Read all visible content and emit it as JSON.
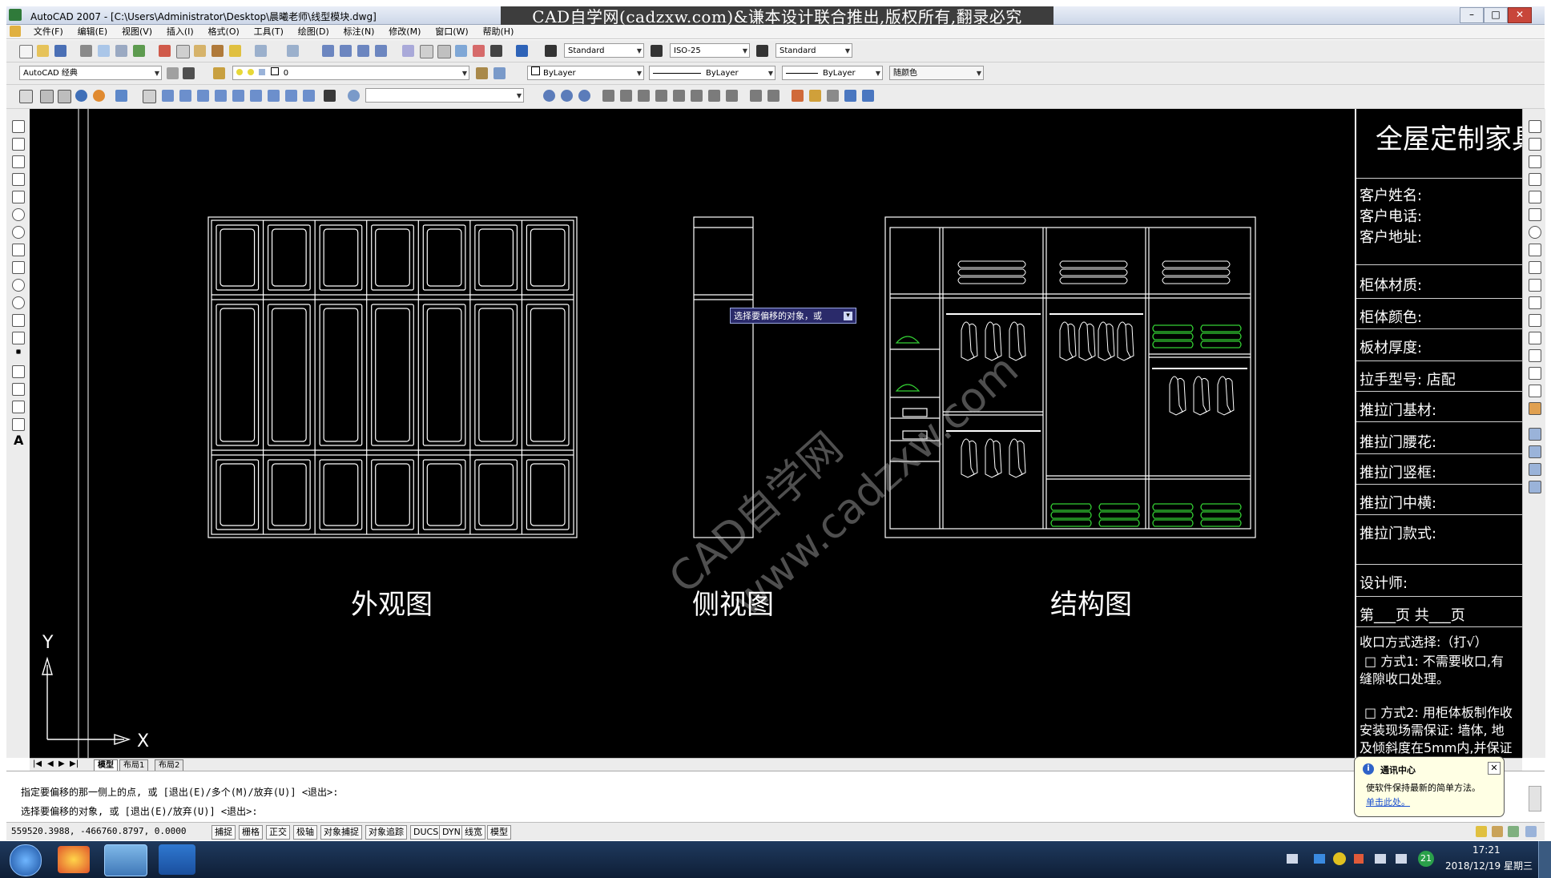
{
  "window": {
    "title": "AutoCAD 2007 - [C:\\Users\\Administrator\\Desktop\\晨曦老师\\线型模块.dwg]",
    "banner": "CAD自学网(cadzxw.com)&谦本设计联合推出,版权所有,翻录必究",
    "controls": [
      "–",
      "□",
      "✕"
    ]
  },
  "menu": [
    "文件(F)",
    "编辑(E)",
    "视图(V)",
    "插入(I)",
    "格式(O)",
    "工具(T)",
    "绘图(D)",
    "标注(N)",
    "修改(M)",
    "窗口(W)",
    "帮助(H)"
  ],
  "toolbar": {
    "text_style": "Standard",
    "dim_style": "ISO-25",
    "table_style": "Standard",
    "workspace": "AutoCAD 经典",
    "layer": "0",
    "color": "ByLayer",
    "linetype": "ByLayer",
    "lineweight": "ByLayer",
    "plotstyle": "随颜色"
  },
  "drawing": {
    "label_exterior": "外观图",
    "label_side": "侧视图",
    "label_structure": "结构图",
    "tooltip": "选择要偏移的对象，或",
    "watermark_1": "CAD自学网",
    "watermark_2": "www.cadzxw.com",
    "axis_y": "Y",
    "axis_x": "X"
  },
  "title_block": {
    "heading": "全屋定制家具",
    "rows": [
      "客户姓名:",
      "客户电话:",
      "客户地址:",
      "柜体材质:",
      "柜体颜色:",
      "板材厚度:",
      "拉手型号: 店配",
      "推拉门基材:",
      "推拉门腰花:",
      "推拉门竖框:",
      "推拉门中横:",
      "推拉门款式:",
      "设计师:",
      "第___页 共___页"
    ],
    "notes": [
      "收口方式选择:（打√）",
      "□ 方式1: 不需要收口,有",
      "缝隙收口处理。",
      "□ 方式2: 用柜体板制作收",
      "安装现场需保证: 墙体, 地",
      "及倾斜度在5mm内,并保证"
    ]
  },
  "tabs": [
    "模型",
    "布局1",
    "布局2"
  ],
  "command": {
    "line1": "指定要偏移的那一侧上的点, 或 [退出(E)/多个(M)/放弃(U)] <退出>:",
    "line2": "选择要偏移的对象, 或 [退出(E)/放弃(U)] <退出>:"
  },
  "status": {
    "coords": "559520.3988, -466760.8797, 0.0000",
    "buttons": [
      "捕捉",
      "栅格",
      "正交",
      "极轴",
      "对象捕捉",
      "对象追踪",
      "DUCS",
      "DYN",
      "线宽",
      "模型"
    ]
  },
  "balloon": {
    "title": "通讯中心",
    "text": "使软件保持最新的简单方法。",
    "link": "单击此处。"
  },
  "taskbar": {
    "time": "17:21",
    "date": "2018/12/19 星期三",
    "badge": "21"
  }
}
